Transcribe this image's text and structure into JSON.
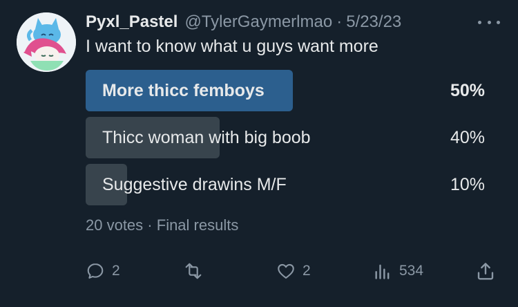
{
  "tweet": {
    "display_name": "Pyxl_Pastel",
    "handle": "@TylerGaymerlmao",
    "separator": "·",
    "date": "5/23/23",
    "text": "I want to know what u guys want more"
  },
  "poll": {
    "options": [
      {
        "label": "More thicc femboys",
        "percent": "50%",
        "fraction": 0.5,
        "winner": true
      },
      {
        "label": "Thicc woman with big boob",
        "percent": "40%",
        "fraction": 0.4,
        "winner": false
      },
      {
        "label": "Suggestive drawins M/F",
        "percent": "10%",
        "fraction": 0.1,
        "winner": false
      }
    ],
    "votes": "20 votes",
    "meta_separator": "·",
    "status": "Final results"
  },
  "actions": {
    "replies": "2",
    "retweets": "",
    "likes": "2",
    "views": "534"
  },
  "colors": {
    "background": "#15202b",
    "winner_bar": "#2c5f8e",
    "bar": "#38444d",
    "muted": "#8b98a5"
  }
}
